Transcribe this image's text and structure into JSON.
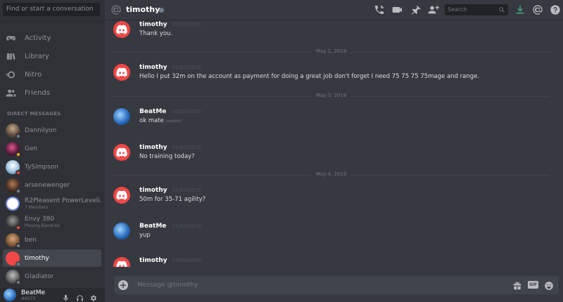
{
  "sidebar": {
    "search_placeholder": "Find or start a conversation",
    "nav": [
      {
        "label": "Activity",
        "icon": "controller-icon"
      },
      {
        "label": "Library",
        "icon": "library-icon"
      },
      {
        "label": "Nitro",
        "icon": "nitro-icon"
      },
      {
        "label": "Friends",
        "icon": "friends-icon"
      }
    ],
    "dm_header": "DIRECT MESSAGES",
    "dms": [
      {
        "name": "Dannilyon",
        "sub": "",
        "status": "offline"
      },
      {
        "name": "Gen",
        "sub": "",
        "status": "idle"
      },
      {
        "name": "TySimpson",
        "sub": "",
        "status": "dnd"
      },
      {
        "name": "arsenewenger",
        "sub": "",
        "status": "offline"
      },
      {
        "name": "R2Pleasent PowerLeveli...",
        "sub": "7 Members",
        "status": "group"
      },
      {
        "name": "Envy 380",
        "sub": "Playing BanaLite",
        "status": "dnd"
      },
      {
        "name": "ben",
        "sub": "",
        "status": "offline"
      },
      {
        "name": "timothy",
        "sub": "",
        "status": "offline"
      },
      {
        "name": "Gladiator",
        "sub": "",
        "status": "offline"
      }
    ],
    "user": {
      "name": "BeatMe",
      "tag": "#6073"
    }
  },
  "header": {
    "channel_name": "timothy",
    "search_placeholder": "Search"
  },
  "messages": [
    {
      "author": "timothy",
      "time": "05/27/2019",
      "text": "Thank you.",
      "avatar": "discord"
    },
    {
      "divider": "May 2, 2019"
    },
    {
      "author": "timothy",
      "time": "05/02/2019",
      "text": "Hello I put 32m on the account as payment for doing a great job don't forget I need 75 75 75 75mage and range.",
      "avatar": "discord"
    },
    {
      "divider": "May 3, 2019"
    },
    {
      "author": "BeatMe",
      "time": "05/03/2019",
      "text": "ok  mate",
      "edited": "(edited)",
      "avatar": "beat"
    },
    {
      "author": "timothy",
      "time": "05/03/2019",
      "text": "No training today?",
      "avatar": "discord"
    },
    {
      "divider": "May 4, 2019"
    },
    {
      "author": "timothy",
      "time": "05/04/2019",
      "text": "50m for 35-71 agility?",
      "avatar": "discord"
    },
    {
      "author": "BeatMe",
      "time": "05/04/2019",
      "text": "yup",
      "avatar": "beat"
    },
    {
      "author": "timothy",
      "time": "05/04/2019",
      "text": "",
      "avatar": "discord"
    }
  ],
  "composer": {
    "placeholder": "Message @timothy",
    "gif_label": "GIF"
  },
  "colors": {
    "accent": "#7289da",
    "download": "#43b581",
    "dnd": "#f04747",
    "idle": "#faa61a",
    "offline": "#747f8d",
    "online": "#43b581"
  }
}
